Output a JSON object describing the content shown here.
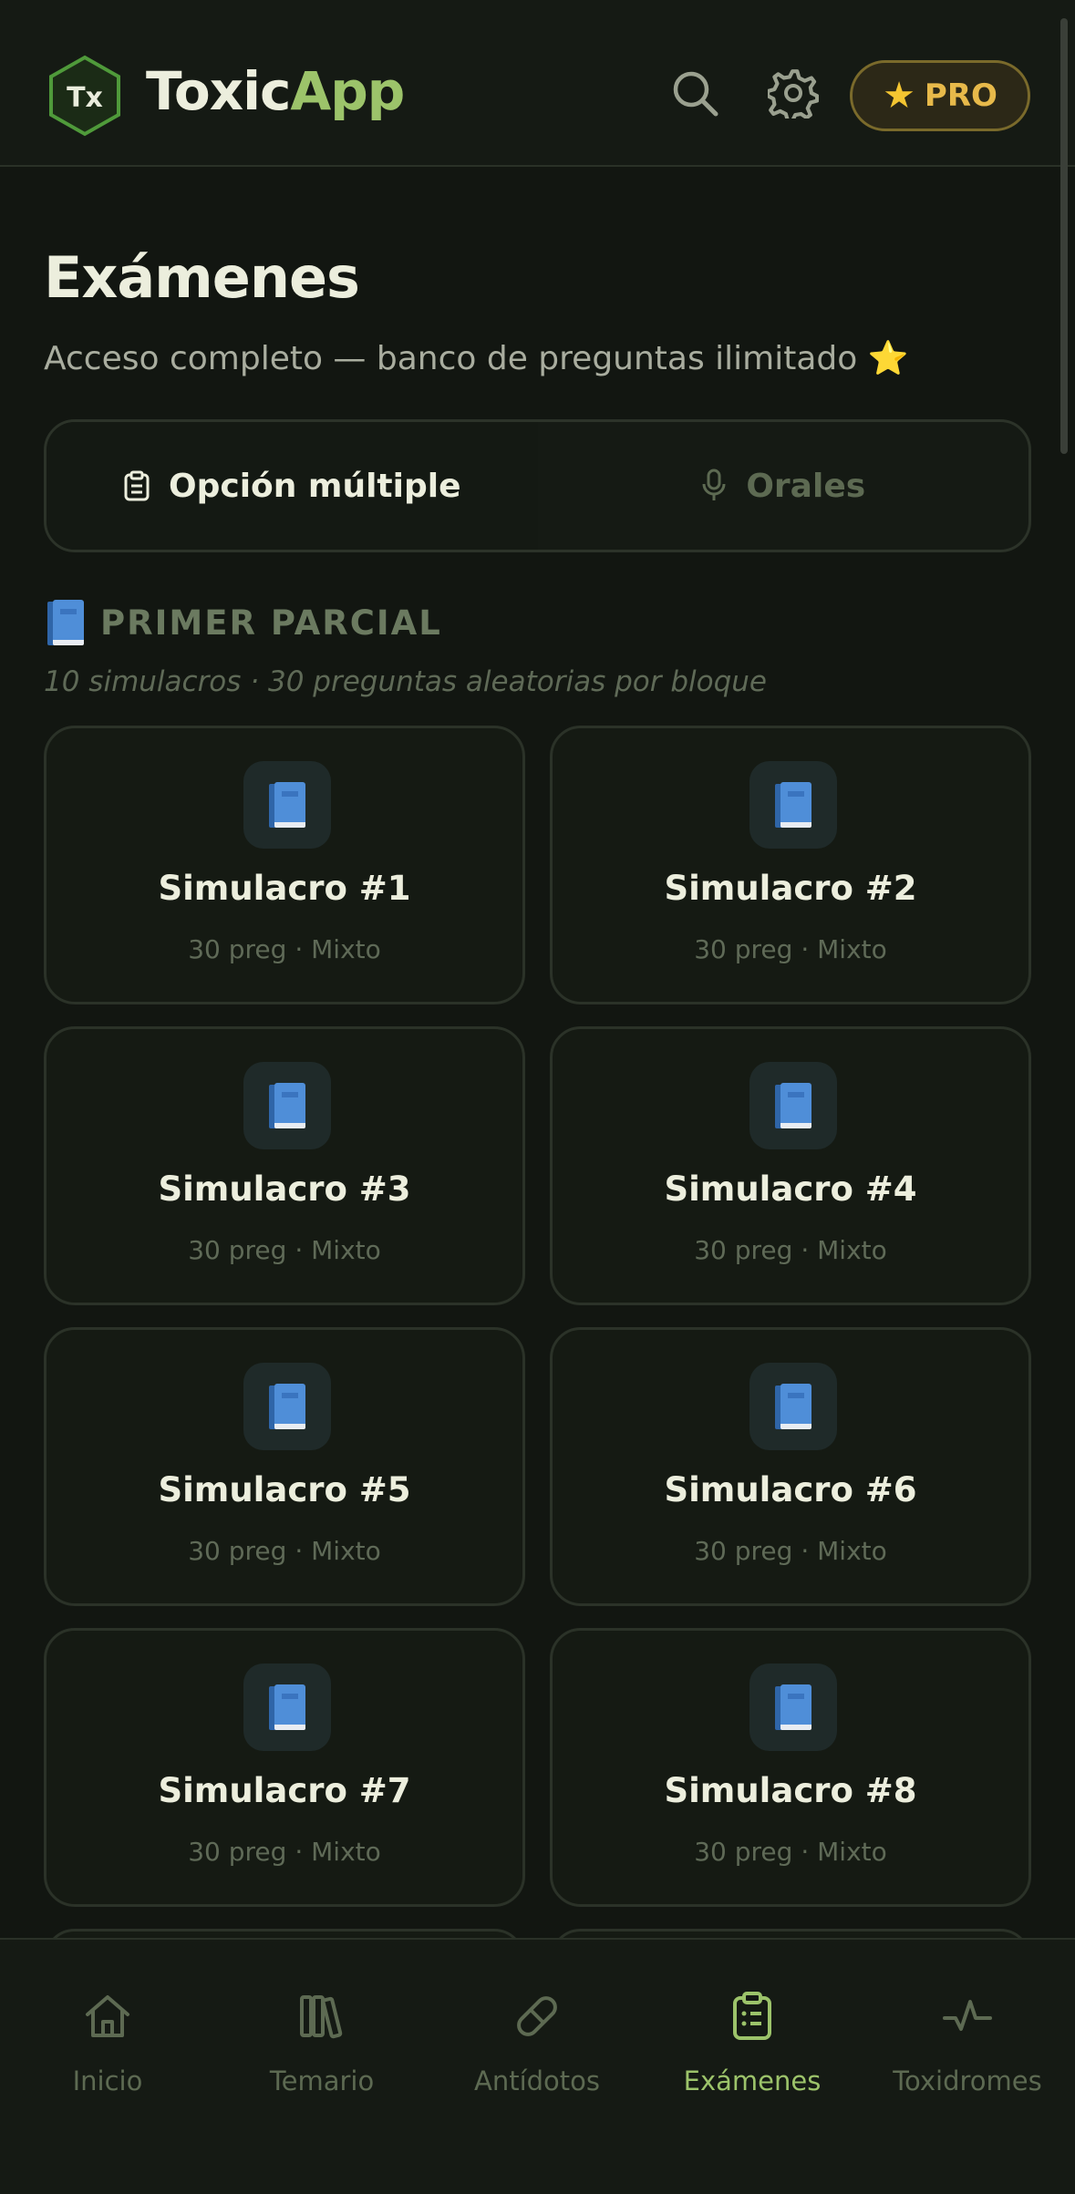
{
  "header": {
    "logo_text": "Tx",
    "app_name_part1": "Toxic",
    "app_name_part2": "App",
    "pro_label": "PRO",
    "icons": [
      "search-icon",
      "gear-icon",
      "star-icon"
    ]
  },
  "page": {
    "title": "Exámenes",
    "subtitle": "Acceso completo — banco de preguntas ilimitado",
    "subtitle_emoji": "⭐"
  },
  "tabs": [
    {
      "label": "Opción múltiple",
      "icon": "clipboard-icon",
      "active": true
    },
    {
      "label": "Orales",
      "icon": "microphone-icon",
      "active": false
    }
  ],
  "section": {
    "title": "PRIMER PARCIAL",
    "icon": "book-icon",
    "description": "10 simulacros · 30 preguntas aleatorias por bloque"
  },
  "cards": [
    {
      "title": "Simulacro #1",
      "meta": "30 preg · Mixto"
    },
    {
      "title": "Simulacro #2",
      "meta": "30 preg · Mixto"
    },
    {
      "title": "Simulacro #3",
      "meta": "30 preg · Mixto"
    },
    {
      "title": "Simulacro #4",
      "meta": "30 preg · Mixto"
    },
    {
      "title": "Simulacro #5",
      "meta": "30 preg · Mixto"
    },
    {
      "title": "Simulacro #6",
      "meta": "30 preg · Mixto"
    },
    {
      "title": "Simulacro #7",
      "meta": "30 preg · Mixto"
    },
    {
      "title": "Simulacro #8",
      "meta": "30 preg · Mixto"
    }
  ],
  "nav": [
    {
      "label": "Inicio",
      "icon": "home-icon",
      "active": false
    },
    {
      "label": "Temario",
      "icon": "books-icon",
      "active": false
    },
    {
      "label": "Antídotos",
      "icon": "pill-icon",
      "active": false
    },
    {
      "label": "Exámenes",
      "icon": "clipboard-icon",
      "active": true
    },
    {
      "label": "Toxidromes",
      "icon": "pulse-icon",
      "active": false
    }
  ],
  "colors": {
    "background": "#121611",
    "accent": "#9cc36a",
    "pro_gold": "#e7b94a",
    "muted": "#5d6a52"
  }
}
